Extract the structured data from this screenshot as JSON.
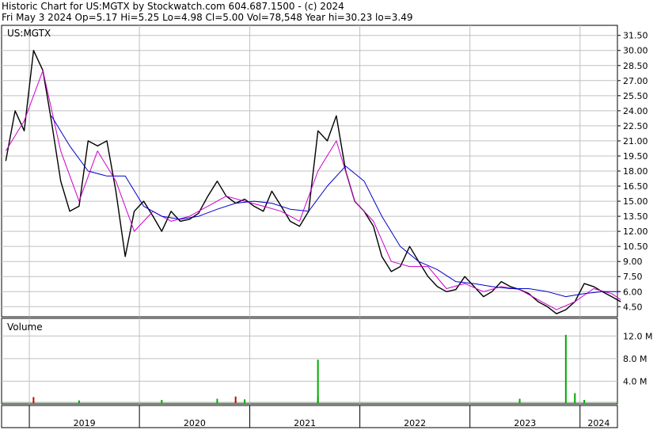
{
  "header": {
    "line1": "Historic Chart for US:MGTX by Stockwatch.com 604.687.1500 - (c) 2024",
    "line2": "Fri May  3 2024   Op=5.17  Hi=5.25  Lo=4.98  Cl=5.00  Vol=78,548  Year hi=30.23  lo=3.49"
  },
  "colors": {
    "price": "#000000",
    "ma_short": "#cc00cc",
    "ma_long": "#0000cc",
    "grid": "#c0c0c0",
    "vol_up": "#00aa00",
    "vol_down": "#cc0000"
  },
  "chart_data": [
    {
      "type": "line",
      "title": "US:MGTX",
      "ylim": [
        3.5,
        32.5
      ],
      "y_ticks": [
        "31.50",
        "30.00",
        "28.50",
        "27.00",
        "25.50",
        "24.00",
        "22.50",
        "21.00",
        "19.50",
        "18.00",
        "16.50",
        "15.00",
        "13.50",
        "12.00",
        "10.50",
        "9.00",
        "7.50",
        "6.00",
        "4.50"
      ],
      "x_ticks": [
        "2019",
        "2020",
        "2021",
        "2022",
        "2023",
        "2024"
      ],
      "grid": true,
      "series": [
        {
          "role": "price",
          "x": [
            "2018-10",
            "2018-11",
            "2018-12",
            "2019-01",
            "2019-02",
            "2019-03",
            "2019-04",
            "2019-05",
            "2019-06",
            "2019-07",
            "2019-08",
            "2019-09",
            "2019-10",
            "2019-11",
            "2019-12",
            "2020-01",
            "2020-02",
            "2020-03",
            "2020-04",
            "2020-05",
            "2020-06",
            "2020-07",
            "2020-08",
            "2020-09",
            "2020-10",
            "2020-11",
            "2020-12",
            "2021-01",
            "2021-02",
            "2021-03",
            "2021-04",
            "2021-05",
            "2021-06",
            "2021-07",
            "2021-08",
            "2021-09",
            "2021-10",
            "2021-11",
            "2021-12",
            "2022-01",
            "2022-02",
            "2022-03",
            "2022-04",
            "2022-05",
            "2022-06",
            "2022-07",
            "2022-08",
            "2022-09",
            "2022-10",
            "2022-11",
            "2022-12",
            "2023-01",
            "2023-02",
            "2023-03",
            "2023-04",
            "2023-05",
            "2023-06",
            "2023-07",
            "2023-08",
            "2023-09",
            "2023-10",
            "2023-11",
            "2023-12",
            "2024-01",
            "2024-02",
            "2024-03",
            "2024-04",
            "2024-05"
          ],
          "values": [
            19.0,
            24.0,
            22.0,
            30.0,
            28.0,
            23.0,
            17.0,
            14.0,
            14.5,
            21.0,
            20.5,
            21.0,
            16.0,
            9.5,
            14.0,
            15.0,
            13.5,
            12.0,
            14.0,
            13.0,
            13.2,
            13.8,
            15.5,
            17.0,
            15.5,
            14.8,
            15.2,
            14.5,
            14.0,
            16.0,
            14.5,
            13.0,
            12.5,
            14.0,
            22.0,
            21.0,
            23.5,
            18.0,
            15.0,
            14.0,
            12.5,
            9.5,
            8.0,
            8.5,
            10.5,
            9.0,
            7.5,
            6.5,
            6.0,
            6.2,
            7.5,
            6.5,
            5.5,
            6.0,
            7.0,
            6.5,
            6.2,
            5.8,
            5.0,
            4.5,
            3.8,
            4.2,
            5.0,
            6.8,
            6.5,
            6.0,
            5.5,
            5.0
          ]
        },
        {
          "role": "ma_short",
          "x": [
            "2018-10",
            "2018-12",
            "2019-02",
            "2019-04",
            "2019-06",
            "2019-08",
            "2019-10",
            "2019-12",
            "2020-02",
            "2020-04",
            "2020-06",
            "2020-08",
            "2020-10",
            "2020-12",
            "2021-02",
            "2021-04",
            "2021-06",
            "2021-08",
            "2021-10",
            "2021-12",
            "2022-02",
            "2022-04",
            "2022-06",
            "2022-08",
            "2022-10",
            "2022-12",
            "2023-02",
            "2023-04",
            "2023-06",
            "2023-08",
            "2023-10",
            "2023-12",
            "2024-02",
            "2024-04",
            "2024-05"
          ],
          "values": [
            20.0,
            23.0,
            28.0,
            20.0,
            15.0,
            20.0,
            17.0,
            12.0,
            14.0,
            13.0,
            13.5,
            14.5,
            15.5,
            15.0,
            14.5,
            14.0,
            13.0,
            18.0,
            21.0,
            15.0,
            13.0,
            9.0,
            8.5,
            8.5,
            6.3,
            6.8,
            6.0,
            6.5,
            6.2,
            5.2,
            4.2,
            5.0,
            6.3,
            5.8,
            5.2
          ]
        },
        {
          "role": "ma_long",
          "x": [
            "2019-03",
            "2019-05",
            "2019-07",
            "2019-09",
            "2019-11",
            "2020-01",
            "2020-03",
            "2020-05",
            "2020-07",
            "2020-09",
            "2020-11",
            "2021-01",
            "2021-03",
            "2021-05",
            "2021-07",
            "2021-09",
            "2021-11",
            "2022-01",
            "2022-03",
            "2022-05",
            "2022-07",
            "2022-09",
            "2022-11",
            "2023-01",
            "2023-03",
            "2023-05",
            "2023-07",
            "2023-09",
            "2023-11",
            "2024-01",
            "2024-03",
            "2024-05"
          ],
          "values": [
            23.5,
            20.5,
            18.0,
            17.5,
            17.5,
            14.5,
            13.5,
            13.2,
            13.5,
            14.2,
            14.8,
            15.0,
            14.8,
            14.2,
            14.0,
            16.5,
            18.5,
            17.0,
            13.5,
            10.5,
            9.0,
            8.2,
            7.0,
            6.8,
            6.5,
            6.3,
            6.3,
            6.0,
            5.5,
            5.8,
            6.0,
            6.0
          ]
        }
      ]
    },
    {
      "type": "bar",
      "title": "Volume",
      "ylim": [
        0,
        14
      ],
      "y_ticks": [
        "12.0 M",
        "8.0 M",
        "4.0 M"
      ],
      "grid": true,
      "spikes": [
        {
          "date": "2019-01",
          "volume": 1.2,
          "direction": "down"
        },
        {
          "date": "2019-06",
          "volume": 0.6,
          "direction": "up"
        },
        {
          "date": "2020-03",
          "volume": 0.7,
          "direction": "up"
        },
        {
          "date": "2020-09",
          "volume": 0.9,
          "direction": "up"
        },
        {
          "date": "2020-11",
          "volume": 1.3,
          "direction": "down"
        },
        {
          "date": "2020-12",
          "volume": 0.8,
          "direction": "up"
        },
        {
          "date": "2021-08",
          "volume": 7.8,
          "direction": "up"
        },
        {
          "date": "2021-08",
          "volume": 1.3,
          "direction": "up"
        },
        {
          "date": "2023-06",
          "volume": 0.9,
          "direction": "up"
        },
        {
          "date": "2023-11",
          "volume": 12.2,
          "direction": "up"
        },
        {
          "date": "2023-12",
          "volume": 1.9,
          "direction": "up"
        },
        {
          "date": "2024-01",
          "volume": 0.7,
          "direction": "up"
        }
      ],
      "baseline_volume": 0.35
    }
  ]
}
